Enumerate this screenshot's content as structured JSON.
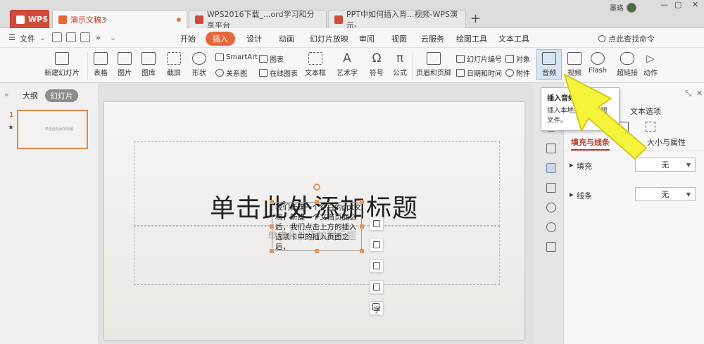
{
  "tabs": [
    {
      "label": "WPS"
    },
    {
      "label": "演示文稿3"
    },
    {
      "label": "WPS2016下载_...ord学习和分享平台"
    },
    {
      "label": "PPT中如何插入背...视频-WPS演示-"
    }
  ],
  "user": {
    "name": "墨珞"
  },
  "menubar": {
    "file_label": "文件",
    "items": [
      "开始",
      "插入",
      "设计",
      "动画",
      "幻灯片放映",
      "审阅",
      "视图",
      "云服务",
      "绘图工具",
      "文本工具"
    ],
    "search_label": "点此查找命令"
  },
  "ribbon": {
    "new_slide": "新建幻灯片",
    "table": "表格",
    "picture": "图片",
    "gallery": "图库",
    "screenshot": "截屏",
    "shape": "形状",
    "smartart": "SmartArt",
    "chart": "图表",
    "relation": "关系图",
    "online_chart": "在线图表",
    "textbox": "文本框",
    "wordart": "艺术字",
    "symbol": "符号",
    "formula": "公式",
    "header_footer": "页眉和页脚",
    "slide_number": "幻灯片编号",
    "object": "对象",
    "datetime": "日期和时间",
    "attachment": "附件",
    "audio": "音频",
    "video": "视频",
    "flash": "Flash",
    "hyperlink": "超链接",
    "action": "动作"
  },
  "leftpane": {
    "outline_tab": "大纲",
    "slides_tab": "幻灯片",
    "slide_number": "1"
  },
  "slide": {
    "title_placeholder": "单击此处添加标题",
    "subtitle_placeholder": "单击此处添加副标题",
    "textbox_text": "我们新建一个空白的ppt文档，新建一个文档页面之后，我们点击上方的插入选项卡中的插入页面之后，"
  },
  "tooltip": {
    "title": "插入音频",
    "desc": "插入本地或在线音频文件。"
  },
  "proppane": {
    "text_options": "文本选项",
    "fill_line": "填充与线条",
    "effects": "效果",
    "size_props": "大小与属性",
    "fill_label": "填充",
    "fill_value": "无",
    "line_label": "线条",
    "line_value": "无"
  },
  "colors": {
    "accent": "#e8673a",
    "wps_red": "#d04b3b",
    "highlight": "#f5f53a"
  }
}
